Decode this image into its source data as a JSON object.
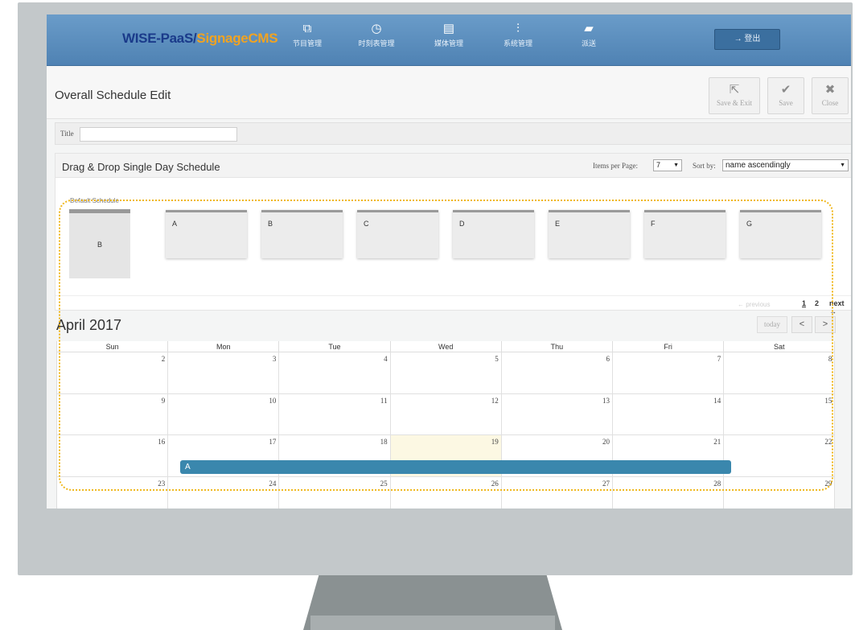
{
  "brand": {
    "part1": "WISE-PaaS/",
    "part2": "SignageCMS"
  },
  "nav": [
    {
      "label": "节目管理",
      "icon": "⧉"
    },
    {
      "label": "时刻表管理",
      "icon": "◷"
    },
    {
      "label": "媒体管理",
      "icon": "▤"
    },
    {
      "label": "系统管理",
      "icon": "⫶"
    },
    {
      "label": "派送",
      "icon": "▰"
    }
  ],
  "logout": {
    "label": "→  登出"
  },
  "page": {
    "title": "Overall Schedule Edit"
  },
  "toolbar": {
    "save_exit": "Save & Exit",
    "save": "Save",
    "close": "Close"
  },
  "title_field": {
    "label": "Title",
    "value": ""
  },
  "dragdrop": {
    "title": "Drag & Drop Single Day Schedule",
    "items_per_page_label": "Items per Page:",
    "items_per_page_value": "7",
    "sort_label": "Sort by:",
    "sort_value": "name ascendingly",
    "default_label": "Default Schedule",
    "default_card": "B",
    "cards": [
      "A",
      "B",
      "C",
      "D",
      "E",
      "F",
      "G"
    ],
    "pagination": {
      "prev": "← previous",
      "pages": [
        "1",
        "2"
      ],
      "next": "next →"
    }
  },
  "calendar": {
    "title": "April 2017",
    "today_label": "today",
    "prev_label": "<",
    "next_label": ">",
    "days_of_week": [
      "Sun",
      "Mon",
      "Tue",
      "Wed",
      "Thu",
      "Fri",
      "Sat"
    ],
    "weeks": [
      [
        "2",
        "3",
        "4",
        "5",
        "6",
        "7",
        "8"
      ],
      [
        "9",
        "10",
        "11",
        "12",
        "13",
        "14",
        "15"
      ],
      [
        "16",
        "17",
        "18",
        "19",
        "20",
        "21",
        "22"
      ],
      [
        "23",
        "24",
        "25",
        "26",
        "27",
        "28",
        "29"
      ]
    ],
    "event": {
      "label": "A"
    }
  },
  "colors": {
    "nav_bg": "#5a8ec0",
    "brand_dark": "#1a3a8a",
    "brand_orange": "#f0a322",
    "event": "#3a87ad",
    "today_bg": "#fcf8e3",
    "highlight": "#f0b81e"
  }
}
